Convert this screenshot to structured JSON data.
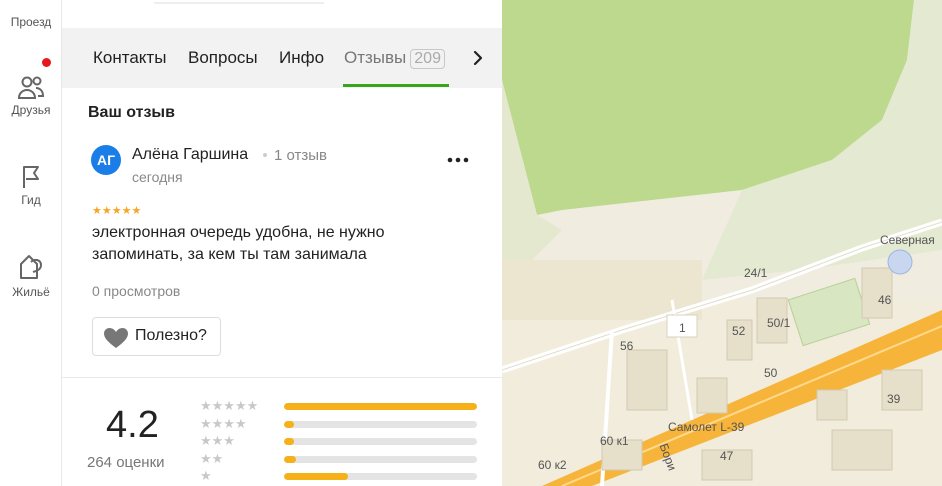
{
  "rail": {
    "items": [
      {
        "label": "Проезд",
        "icon": "route-icon"
      },
      {
        "label": "Друзья",
        "icon": "friends-icon"
      },
      {
        "label": "Гид",
        "icon": "flag-icon"
      },
      {
        "label": "Жильё",
        "icon": "house-icon"
      }
    ],
    "notification_color": "#e5191d"
  },
  "tabs": {
    "items": [
      "Контакты",
      "Вопросы",
      "Инфо",
      "Отзывы"
    ],
    "reviews_count": "209",
    "active": "Отзывы",
    "accent": "#3aa41f"
  },
  "review": {
    "section_title": "Ваш отзыв",
    "avatar_initials": "АГ",
    "avatar_color": "#1b7ee8",
    "author": "Алёна Гаршина",
    "author_reviews": "1 отзыв",
    "date": "сегодня",
    "stars": "★★★★★",
    "rating": 5,
    "text": "электронная очередь удобна, не нужно запоминать, за кем ты там занимала",
    "views": "0 просмотров",
    "useful_label": "Полезно?"
  },
  "summary": {
    "average": "4.2",
    "count_label": "264 оценки",
    "distribution": [
      {
        "stars": "★★★★★",
        "fraction": 1.0
      },
      {
        "stars": "★★★★",
        "fraction": 0.05
      },
      {
        "stars": "★★★",
        "fraction": 0.05
      },
      {
        "stars": "★★",
        "fraction": 0.06
      },
      {
        "stars": "★",
        "fraction": 0.33
      }
    ],
    "bar_color": "#f5b117"
  },
  "map": {
    "labels": [
      "Северная",
      "24/1",
      "46",
      "1",
      "52",
      "50/1",
      "56",
      "50",
      "39",
      "Самолет L-39",
      "60 к1",
      "47",
      "60 к2",
      "Бори"
    ]
  }
}
